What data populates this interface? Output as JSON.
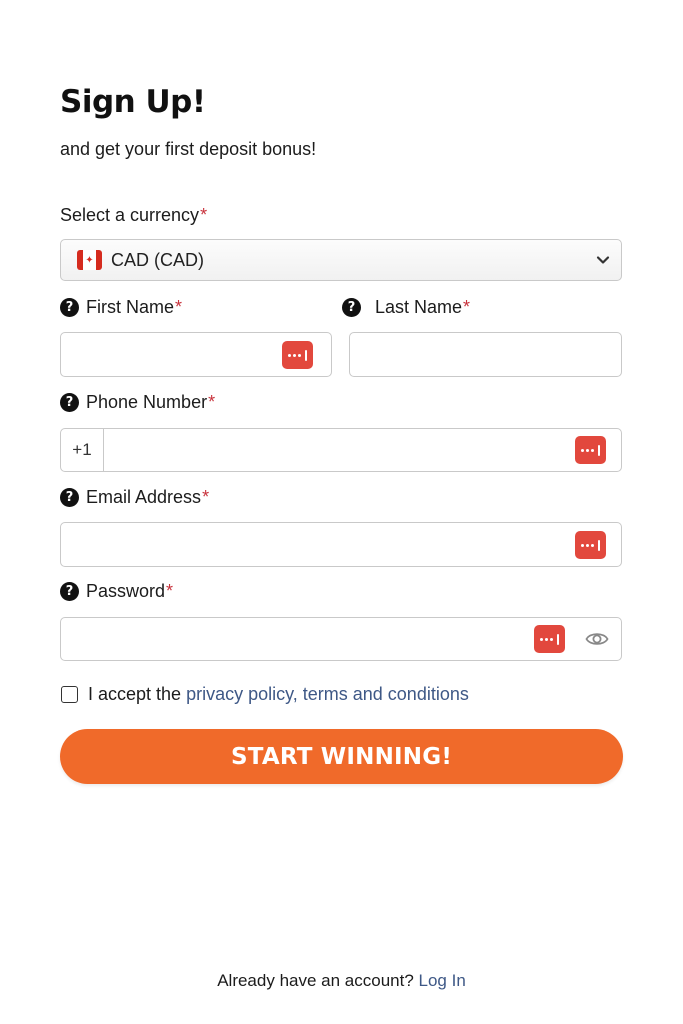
{
  "header": {
    "title": "Sign Up!",
    "subtitle": "and get your first deposit bonus!"
  },
  "currency": {
    "label": "Select a currency",
    "required_mark": "*",
    "selected": "CAD (CAD)",
    "flag_icon": "canada-flag-icon"
  },
  "fields": {
    "first_name": {
      "label": "First Name",
      "required_mark": "*",
      "value": ""
    },
    "last_name": {
      "label": "Last Name",
      "required_mark": "*",
      "value": ""
    },
    "phone": {
      "label": "Phone Number",
      "required_mark": "*",
      "prefix": "+1",
      "value": ""
    },
    "email": {
      "label": "Email Address",
      "required_mark": "*",
      "value": ""
    },
    "password": {
      "label": "Password",
      "required_mark": "*",
      "value": ""
    }
  },
  "help_glyph": "?",
  "terms": {
    "prefix": "I accept the ",
    "link": "privacy policy, terms and conditions",
    "checked": false
  },
  "cta": {
    "label": "START WINNING!"
  },
  "footer": {
    "text": "Already have an account? ",
    "link": "Log In"
  },
  "colors": {
    "accent": "#f06a2a",
    "link": "#3e5886",
    "required": "#c8323c",
    "password_manager_badge": "#e2483d"
  }
}
